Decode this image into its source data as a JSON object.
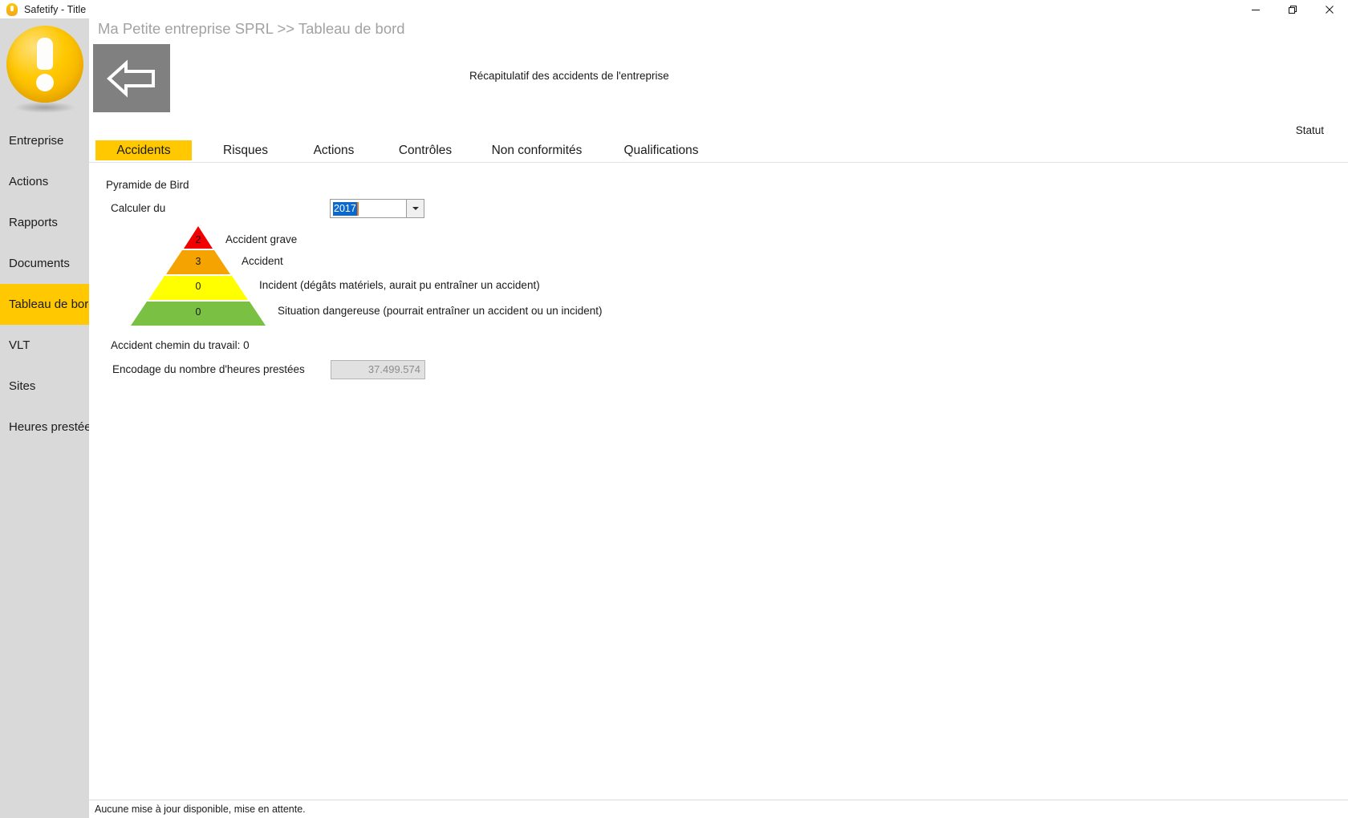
{
  "window": {
    "title": "Safetify - Title",
    "icon": "app-logo-icon",
    "controls": {
      "minimize": "minimize-icon",
      "maximize": "maximize-icon",
      "close": "close-icon"
    }
  },
  "sidebar": {
    "logo": "safetify-logo",
    "items": [
      {
        "label": "Entreprise",
        "active": false
      },
      {
        "label": "Actions",
        "active": false
      },
      {
        "label": "Rapports",
        "active": false
      },
      {
        "label": "Documents",
        "active": false
      },
      {
        "label": "Tableau de bord",
        "active": true
      },
      {
        "label": "VLT",
        "active": false
      },
      {
        "label": "Sites",
        "active": false
      },
      {
        "label": "Heures prestées",
        "active": false
      }
    ]
  },
  "header": {
    "breadcrumb": "Ma Petite entreprise SPRL >> Tableau de bord",
    "back_button_icon": "back-arrow-icon",
    "subtitle": "Récapitulatif des accidents de l'entreprise",
    "status_label": "Statut"
  },
  "tabs": [
    {
      "label": "Accidents",
      "active": true
    },
    {
      "label": "Risques",
      "active": false
    },
    {
      "label": "Actions",
      "active": false
    },
    {
      "label": "Contrôles",
      "active": false
    },
    {
      "label": "Non conformités",
      "active": false
    },
    {
      "label": "Qualifications",
      "active": false
    }
  ],
  "panel": {
    "heading": "Pyramide de Bird",
    "calculate_label": "Calculer du",
    "year_value": "2017",
    "commute_line": "Accident chemin du travail: 0",
    "hours_label": "Encodage du nombre d'heures prestées",
    "hours_value": "37.499.574"
  },
  "chart_data": {
    "type": "pyramid",
    "title": "Pyramide de Bird",
    "tiers": [
      {
        "value": "2",
        "label": "Accident grave",
        "color": "#f20000"
      },
      {
        "value": "3",
        "label": "Accident",
        "color": "#f5a300"
      },
      {
        "value": "0",
        "label": "Incident (dégâts matériels, aurait pu entraîner un accident)",
        "color": "#ffff00"
      },
      {
        "value": "0",
        "label": "Situation dangereuse (pourrait entraîner un accident ou un incident)",
        "color": "#7ac143"
      }
    ],
    "values": [
      2,
      3,
      0,
      0
    ],
    "categories": [
      "Accident grave",
      "Accident",
      "Incident (dégâts matériels, aurait pu entraîner un accident)",
      "Situation dangereuse (pourrait entraîner un accident ou un incident)"
    ],
    "legend": "none",
    "grid": false
  },
  "statusbar": {
    "message": "Aucune mise à jour disponible, mise en attente."
  },
  "colors": {
    "accent": "#ffc800",
    "sidebar_bg": "#d9d9d9",
    "back_button_bg": "#808080",
    "breadcrumb_text": "#a2a2a2",
    "selection_blue": "#0b68ce",
    "caret_orange": "#e87722"
  }
}
